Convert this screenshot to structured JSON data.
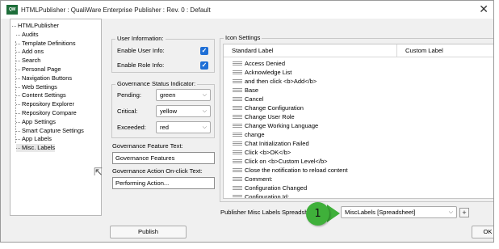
{
  "window": {
    "title": "HTMLPublisher : QualiWare Enterprise Publisher : Rev. 0 : Default",
    "logo_text": "QW",
    "close_glyph": "✕"
  },
  "tree": {
    "items": [
      {
        "label": "HTMLPublisher",
        "selected": false
      },
      {
        "label": "Audits",
        "selected": false
      },
      {
        "label": "Template Definitions",
        "selected": false
      },
      {
        "label": "Add ons",
        "selected": false
      },
      {
        "label": "Search",
        "selected": false
      },
      {
        "label": "Personal Page",
        "selected": false
      },
      {
        "label": "Navigation Buttons",
        "selected": false
      },
      {
        "label": "Web Settings",
        "selected": false
      },
      {
        "label": "Content Settings",
        "selected": false
      },
      {
        "label": "Repository Explorer",
        "selected": false
      },
      {
        "label": "Repository Compare",
        "selected": false
      },
      {
        "label": "App Settings",
        "selected": false
      },
      {
        "label": "Smart Capture Settings",
        "selected": false
      },
      {
        "label": "App Labels",
        "selected": false
      },
      {
        "label": "Misc. Labels",
        "selected": true
      }
    ]
  },
  "user_info": {
    "legend": "User Information:",
    "enable_user_info_label": "Enable User Info:",
    "enable_role_info_label": "Enable Role Info:",
    "checkmark": "✓"
  },
  "governance_status": {
    "legend": "Governance Status Indicator:",
    "pending_label": "Pending:",
    "pending_value": "green",
    "critical_label": "Critical:",
    "critical_value": "yellow",
    "exceeded_label": "Exceeded:",
    "exceeded_value": "red",
    "chevron": "⌵"
  },
  "governance_feature": {
    "label": "Governance Feature Text:",
    "value": "Governance Features"
  },
  "governance_action": {
    "label": "Governance Action On-click Text:",
    "value": "Performing Action..."
  },
  "icon_settings": {
    "legend": "Icon Settings",
    "columns": [
      "Standard Label",
      "Custom Label"
    ],
    "rows": [
      "Access Denied",
      "Acknowledge List",
      "and then click <b>Add</b>",
      "Base",
      "Cancel",
      "Change Configuration",
      "Change User Role",
      "Change Working Language",
      "change",
      "Chat Initialization Failed",
      "Click <b>OK</b>",
      "Click on <b>Custom Level</b>",
      "Close the notification to reload content",
      "Comment:",
      "Configuration Changed",
      "Configuration Id:"
    ]
  },
  "publisher_labels": {
    "label": "Publisher Misc Labels Spreadsheet:",
    "value": "MiscLabels [Spreadsheet]",
    "add_glyph": "+"
  },
  "callout": {
    "number": "1",
    "color": "#3fb03a"
  },
  "buttons": {
    "publish": "Publish",
    "ok": "OK"
  }
}
